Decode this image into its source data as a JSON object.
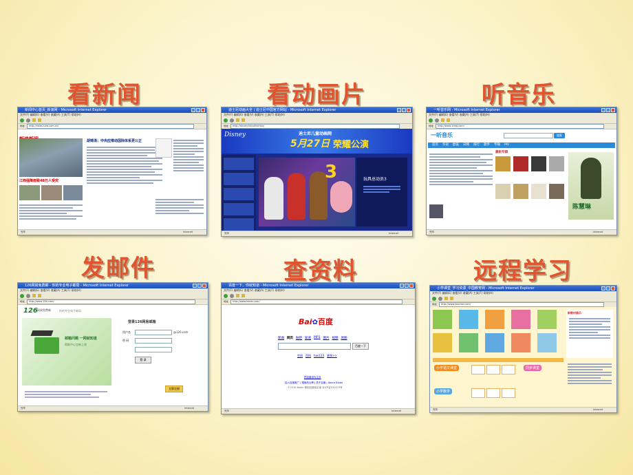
{
  "labels": {
    "news": "看新闻",
    "animation": "看动画片",
    "music": "听音乐",
    "mail": "发邮件",
    "search": "查资料",
    "learning": "远程学习"
  },
  "screens": {
    "news": {
      "title": "新闻中心首页_新浪网 - Microsoft Internet Explorer",
      "menu": "文件(F)  编辑(E)  查看(V)  收藏(A)  工具(T)  帮助(H)",
      "url": "http://news.sina.com.cn/",
      "logo": "新浪新闻",
      "headline": "胡锦涛：中央应推动国际体系更公正",
      "photo_caption": "江西强降雨致48万人受灾",
      "status": "完毕",
      "zone": "Internet"
    },
    "animation": {
      "title": "迪士尼动画大全 | 迪士尼中国官方网站 - Microsoft Internet Explorer",
      "menu": "文件(F)  编辑(E)  查看(V)  收藏(A)  工具(T)  帮助(H)",
      "url": "http://disney.hk/collection/",
      "banner_sub": "迪士尼儿童动画网",
      "banner_date": "5月27日",
      "banner_main": "荣耀公演",
      "movie": "玩具总动员3",
      "status": "完毕",
      "zone": "Internet"
    },
    "music": {
      "title": "一听音乐网 - Microsoft Internet Explorer",
      "menu": "文件(F)  编辑(E)  查看(V)  收藏(A)  工具(T)  帮助(H)",
      "url": "http://www.1ting.com/",
      "logo": "一听音乐",
      "search_btn": "搜索",
      "nav": [
        "首页",
        "华语",
        "欧美",
        "日韩",
        "排行",
        "歌手",
        "专辑",
        "MV"
      ],
      "section": "最新专辑",
      "singer": "陈慧琳",
      "status": "完毕",
      "zone": "Internet"
    },
    "mail": {
      "title": "126网易免费邮 - 你的专业电子邮局 - Microsoft Internet Explorer",
      "menu": "文件(F)  编辑(E)  查看(V)  收藏(A)  工具(T)  帮助(H)",
      "url": "http://www.126.com/",
      "logo": "126",
      "logo_sub": "网易免费邮",
      "slogan": "你的专业电子邮局",
      "promo1": "邮箱问题 一网就知道",
      "promo2": "帮助中心全新上线",
      "login_title": "登录126网易邮箱",
      "user_label": "用户名",
      "user_suffix": "@126.com",
      "pass_label": "密 码",
      "login_btn": "登 录",
      "register_btn": "立即注册",
      "status": "完毕",
      "zone": "Internet"
    },
    "search": {
      "title": "百度一下，你就知道 - Microsoft Internet Explorer",
      "menu": "文件(F)  编辑(E)  查看(V)  收藏(A)  工具(T)  帮助(H)",
      "url": "http://www.baidu.com/",
      "logo_text": "Bai",
      "logo_cn": "百度",
      "tabs": [
        "新闻",
        "网页",
        "贴吧",
        "知道",
        "MP3",
        "图片",
        "视频",
        "地图"
      ],
      "search_btn": "百度一下",
      "links": [
        "空间",
        "百科",
        "hao123",
        "更多>>"
      ],
      "footer1": "把百度设为主页",
      "footer2": "加入百度推广 | 搜索风云榜 | 关于百度 | About Baidu",
      "footer3": "©2010 Baidu 使用百度前必读 京ICP证030173号",
      "status": "完毕",
      "zone": "Internet"
    },
    "learning": {
      "title": "小学课堂_学习资源_中国教育网 - Microsoft Internet Explorer",
      "menu": "文件(F)  编辑(E)  查看(V)  收藏(A)  工具(T)  帮助(H)",
      "url": "http://www.teacher.com/",
      "section1": "小学语文课堂",
      "section2": "小学数学",
      "section3": "同步课堂",
      "side_title": "新教材展示",
      "status": "完毕",
      "zone": "Internet"
    }
  }
}
